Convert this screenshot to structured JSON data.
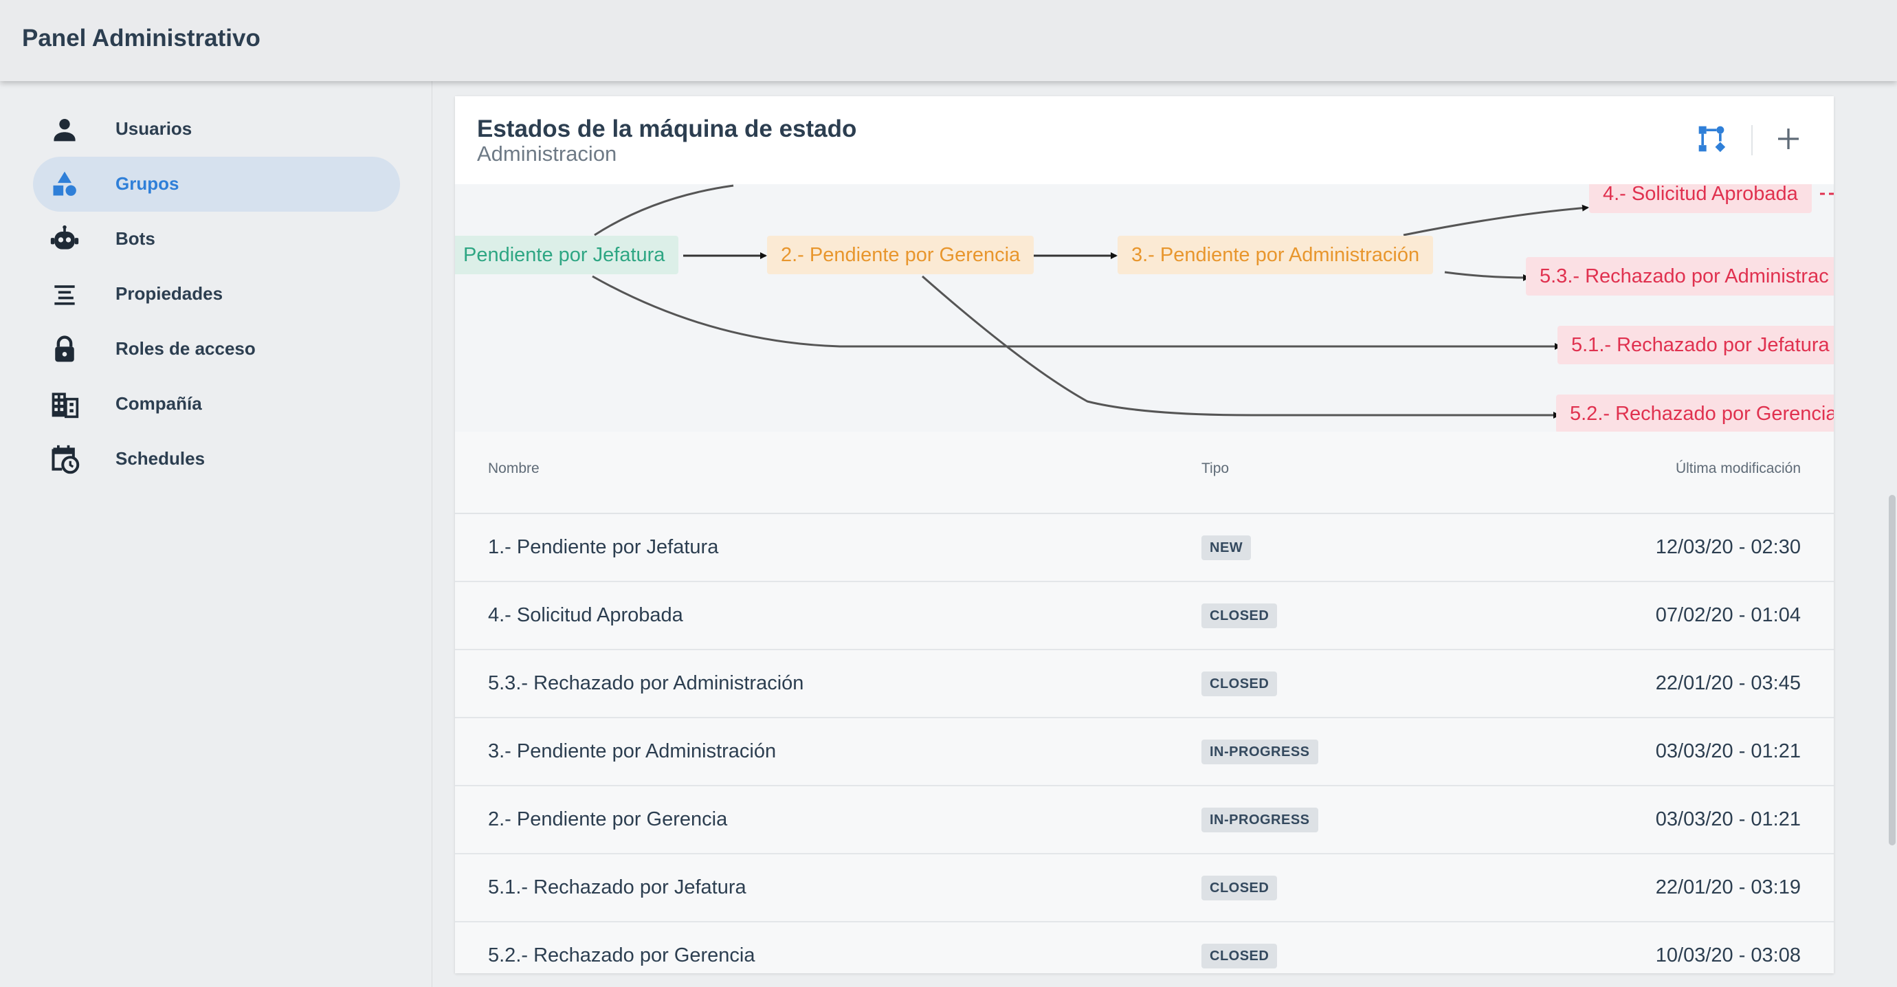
{
  "app": {
    "title": "Panel Administrativo"
  },
  "sidebar": {
    "items": [
      {
        "label": "Usuarios",
        "icon": "person-icon"
      },
      {
        "label": "Grupos",
        "icon": "shapes-icon",
        "active": true
      },
      {
        "label": "Bots",
        "icon": "robot-icon"
      },
      {
        "label": "Propiedades",
        "icon": "sort-lines-icon"
      },
      {
        "label": "Roles de acceso",
        "icon": "lock-icon"
      },
      {
        "label": "Compañía",
        "icon": "building-icon"
      },
      {
        "label": "Schedules",
        "icon": "calendar-clock-icon"
      }
    ]
  },
  "card": {
    "title": "Estados de la máquina de estado",
    "subtitle": "Administracion",
    "actions": {
      "diagram": "flow-diagram-icon",
      "add": "plus-icon"
    }
  },
  "diagram": {
    "nodes": {
      "n1": "Pendiente por Jefatura",
      "n2": "2.- Pendiente por Gerencia",
      "n3": "3.- Pendiente por Administración",
      "n4": "4.- Solicitud Aprobada",
      "n53": "5.3.- Rechazado por Administrac",
      "n51": "5.1.- Rechazado por Jefatura",
      "n52": "5.2.- Rechazado por Gerencia"
    }
  },
  "table": {
    "columns": {
      "name": "Nombre",
      "type": "Tipo",
      "modified": "Última modificación"
    },
    "rows": [
      {
        "name": "1.- Pendiente por Jefatura",
        "type": "NEW",
        "modified": "12/03/20 - 02:30"
      },
      {
        "name": "4.- Solicitud Aprobada",
        "type": "CLOSED",
        "modified": "07/02/20 - 01:04"
      },
      {
        "name": "5.3.- Rechazado por Administración",
        "type": "CLOSED",
        "modified": "22/01/20 - 03:45"
      },
      {
        "name": "3.- Pendiente por Administración",
        "type": "IN-PROGRESS",
        "modified": "03/03/20 - 01:21"
      },
      {
        "name": "2.- Pendiente por Gerencia",
        "type": "IN-PROGRESS",
        "modified": "03/03/20 - 01:21"
      },
      {
        "name": "5.1.- Rechazado por Jefatura",
        "type": "CLOSED",
        "modified": "22/01/20 - 03:19"
      },
      {
        "name": "5.2.- Rechazado por Gerencia",
        "type": "CLOSED",
        "modified": "10/03/20 - 03:08"
      }
    ]
  }
}
